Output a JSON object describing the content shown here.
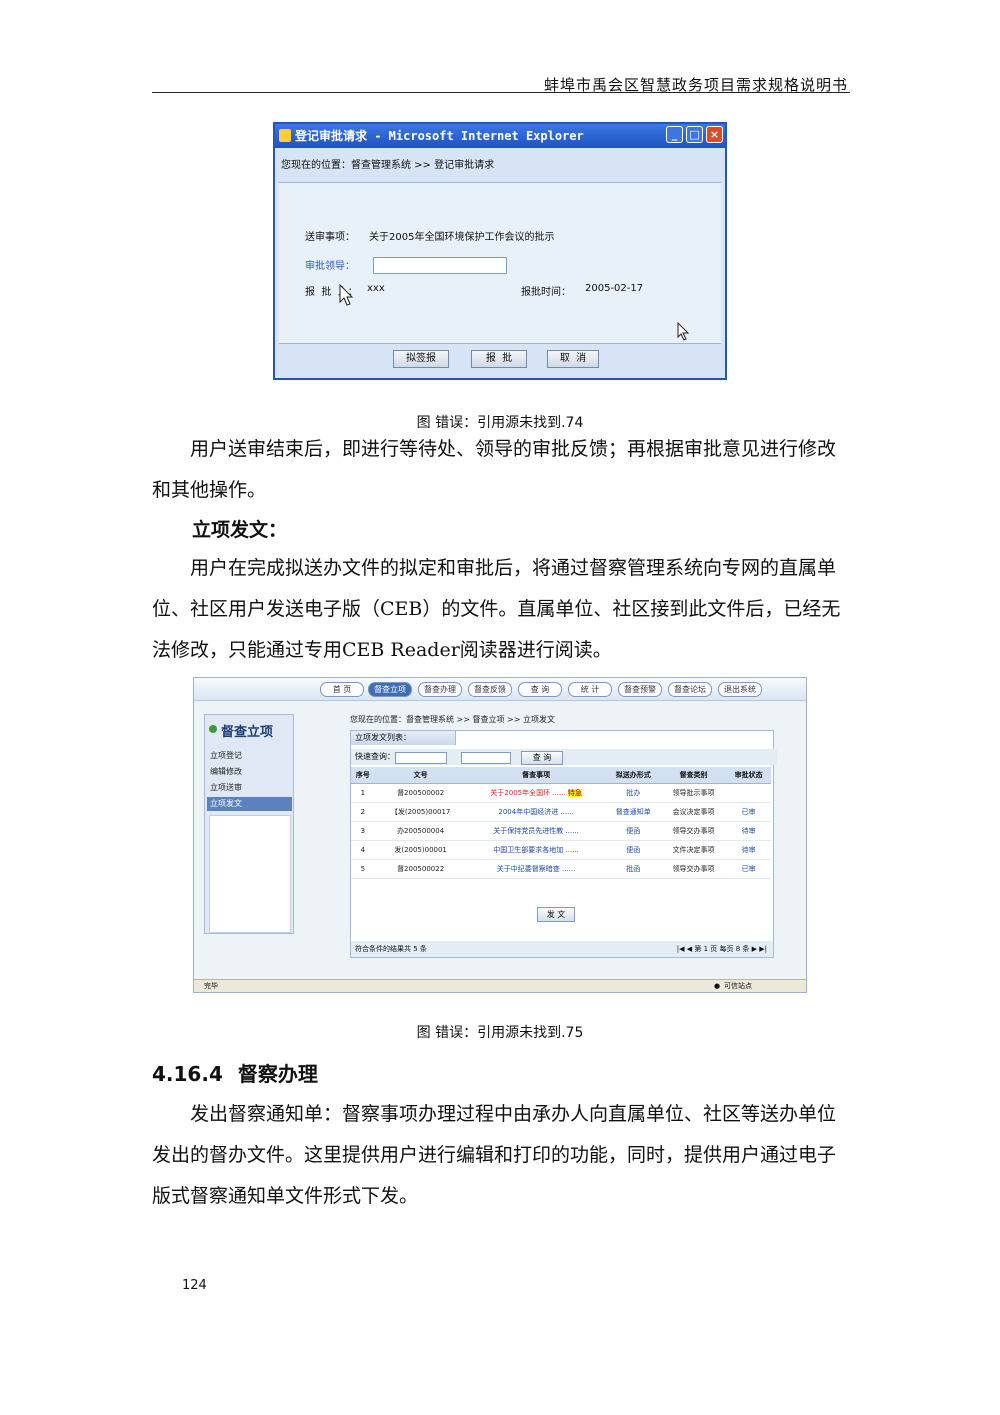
{
  "header": {
    "title": "蚌埠市禹会区智慧政务项目需求规格说明书"
  },
  "figure1": {
    "window_title": "登记审批请求 - Microsoft Internet Explorer",
    "breadcrumb": "您现在的位置：督查管理系统 >> 登记审批请求",
    "subject_label": "送审事项：",
    "subject_value": "关于2005年全国环境保护工作会议的批示",
    "approver_label": "审批领导：",
    "approver_value": "",
    "submitter_label": "报  批  人：",
    "submitter_value": "xxx",
    "time_label": "报批时间：",
    "time_value": "2005-02-17",
    "buttons": [
      "拟签报",
      "报  批",
      "取  消"
    ],
    "caption": "图 错误：引用源未找到.74"
  },
  "para1": "用户送审结束后，即进行等待处、领导的审批反馈；再根据审批意见进行修改和其他操作。",
  "heading_lixiang": "立项发文：",
  "para2": "用户在完成拟送办文件的拟定和审批后，将通过督察管理系统向专网的直属单位、社区用户发送电子版（CEB）的文件。直属单位、社区接到此文件后，已经无法修改，只能通过专用CEB  Reader阅读器进行阅读。",
  "figure2": {
    "nav_tabs": [
      "首  页",
      "督查立项",
      "督查办理",
      "督查反馈",
      "查  询",
      "统  计",
      "督查预警",
      "督查论坛",
      "退出系统"
    ],
    "sidebar_title": "督查立项",
    "sidebar_items": [
      "立项登记",
      "编辑修改",
      "立项送审",
      "立项发文"
    ],
    "breadcrumb": "您现在的位置：督查管理系统 >> 督查立项 >> 立项发文",
    "panel_title": "立项发文列表：",
    "quick_label": "快速查询：",
    "search_button": "查  询",
    "columns": [
      "序号",
      "文号",
      "督查事项",
      "拟送办形式",
      "督查类别",
      "审批状态"
    ],
    "rows": [
      [
        "1",
        "督200500002",
        "关于2005年全国环 ......",
        "批办",
        "领导批示事项",
        ""
      ],
      [
        "2",
        "【发(2005)00017",
        "2004年中国经济进 ......",
        "督查通知单",
        "会议决定事项",
        "已审"
      ],
      [
        "3",
        "办200500004",
        "关于保持党员先进性教 ......",
        "便函",
        "领导交办事项",
        "待审"
      ],
      [
        "4",
        "发(2005)00001",
        "中国卫生部要求各地加 ......",
        "便函",
        "文件决定事项",
        "待审"
      ],
      [
        "5",
        "督200500022",
        "关于中纪委督察暗查 ......",
        "批函",
        "领导交办事项",
        "已审"
      ]
    ],
    "urgent_tag": "特急",
    "send_button": "发  文",
    "result_text": "符合条件的结果共 5 条",
    "pager_text": "第 1 页 每页 8 条",
    "status_left": "完毕",
    "status_right": "可信站点",
    "caption": "图 错误：引用源未找到.75"
  },
  "section_number": "4.16.4",
  "section_title": "督察办理",
  "para3": "发出督察通知单：督察事项办理过程中由承办人向直属单位、社区等送办单位发出的督办文件。这里提供用户进行编辑和打印的功能，同时，提供用户通过电子版式督察通知单文件形式下发。",
  "page_number": "124"
}
